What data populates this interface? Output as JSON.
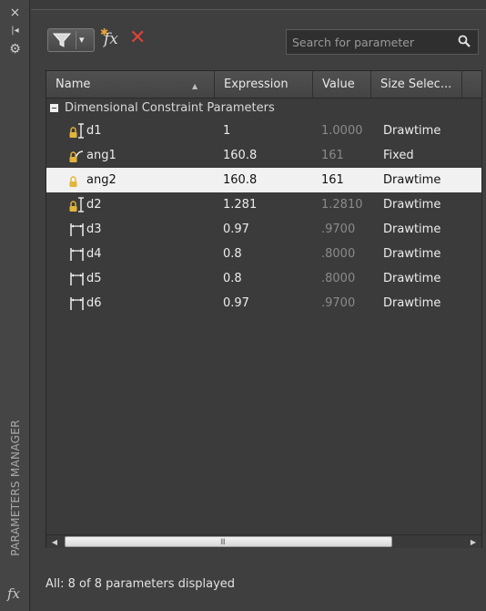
{
  "strip": {
    "close_glyph": "×",
    "autohide_glyph": "|◂",
    "settings_glyph": "⚙",
    "title": "PARAMETERS MANAGER",
    "fx_glyph": "fx"
  },
  "toolbar": {
    "filter_icon": "funnel-icon",
    "new_parameter_icon": "fx-icon",
    "delete_icon": "delete-x-icon",
    "delete_color": "#e0413a",
    "search_placeholder": "Search for parameter"
  },
  "grid": {
    "columns": [
      "Name",
      "Expression",
      "Value",
      "Size Selec..."
    ],
    "group": "Dimensional Constraint Parameters",
    "rows": [
      {
        "name": "d1",
        "expression": "1",
        "value": "1.0000",
        "size": "Drawtime",
        "value_dim": true,
        "icon": "linear-dimension-lock-icon"
      },
      {
        "name": "ang1",
        "expression": "160.8",
        "value": "161",
        "size": "Fixed",
        "value_dim": true,
        "icon": "angular-dimension-lock-icon"
      },
      {
        "name": "ang2",
        "expression": "160.8",
        "value": "161",
        "size": "Drawtime",
        "value_dim": false,
        "icon": "angular-dimension-lock-icon",
        "selected": true
      },
      {
        "name": "d2",
        "expression": "1.281",
        "value": "1.2810",
        "size": "Drawtime",
        "value_dim": true,
        "icon": "linear-dimension-lock-icon"
      },
      {
        "name": "d3",
        "expression": "0.97",
        "value": ".9700",
        "size": "Drawtime",
        "value_dim": true,
        "icon": "horizontal-dimension-icon"
      },
      {
        "name": "d4",
        "expression": "0.8",
        "value": ".8000",
        "size": "Drawtime",
        "value_dim": true,
        "icon": "horizontal-dimension-icon"
      },
      {
        "name": "d5",
        "expression": "0.8",
        "value": ".8000",
        "size": "Drawtime",
        "value_dim": true,
        "icon": "horizontal-dimension-icon"
      },
      {
        "name": "d6",
        "expression": "0.97",
        "value": ".9700",
        "size": "Drawtime",
        "value_dim": true,
        "icon": "horizontal-dimension-icon"
      }
    ]
  },
  "scrollbar": {
    "left_arrow": "◀",
    "right_arrow": "▶",
    "grip": "III"
  },
  "status": "All: 8 of 8 parameters displayed",
  "colors": {
    "panel_bg": "#3f3f3f",
    "selected_row": "#f1f1f1",
    "lock_gold": "#e3b43a"
  }
}
